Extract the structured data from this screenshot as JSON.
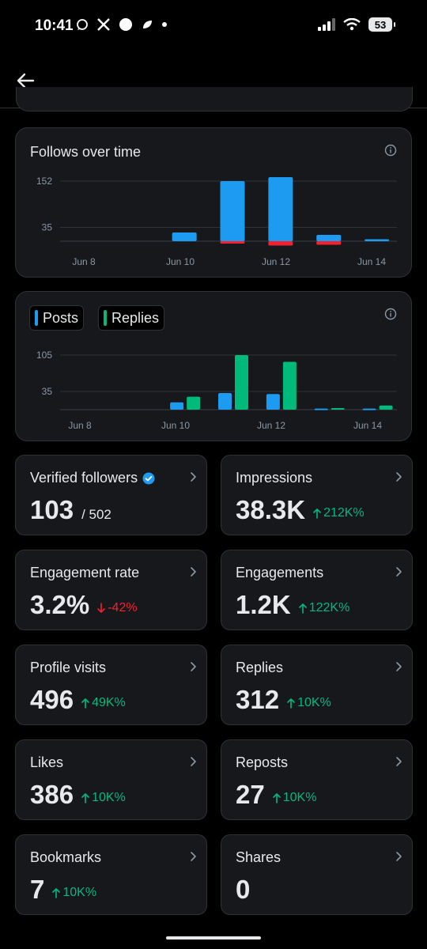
{
  "status_bar": {
    "time": "10:41",
    "battery": "53"
  },
  "colors": {
    "blue": "#1d9bf0",
    "green": "#00ba7c",
    "red": "#f4212e",
    "card": "#16181c",
    "border": "#2f3336"
  },
  "follows_chart": {
    "title": "Follows over time",
    "chart_data": {
      "type": "bar",
      "categories": [
        "Jun 8",
        "Jun 9",
        "Jun 10",
        "Jun 11",
        "Jun 12",
        "Jun 13",
        "Jun 14"
      ],
      "xtick_labels": [
        "Jun 8",
        "Jun 10",
        "Jun 12",
        "Jun 14"
      ],
      "yticks": [
        35,
        152
      ],
      "series": [
        {
          "values": [
            0,
            0,
            22,
            152,
            162,
            16,
            5
          ]
        },
        {
          "values": [
            0,
            0,
            0,
            -6,
            -11,
            -9,
            0
          ]
        }
      ],
      "ylim": [
        -20,
        165
      ],
      "grid": true
    }
  },
  "posts_replies_chart": {
    "legend": [
      "Posts",
      "Replies"
    ],
    "chart_data": {
      "type": "bar",
      "categories": [
        "Jun 8",
        "Jun 9",
        "Jun 10",
        "Jun 11",
        "Jun 12",
        "Jun 13",
        "Jun 14"
      ],
      "xtick_labels": [
        "Jun 8",
        "Jun 10",
        "Jun 12",
        "Jun 14"
      ],
      "yticks": [
        35,
        105
      ],
      "series": [
        {
          "name": "Posts",
          "values": [
            0,
            0,
            14,
            32,
            30,
            2,
            2
          ]
        },
        {
          "name": "Replies",
          "values": [
            0,
            0,
            25,
            105,
            92,
            3,
            8
          ]
        }
      ],
      "ylim": [
        0,
        115
      ],
      "grid": true
    }
  },
  "metrics": [
    {
      "label": "Verified followers",
      "value": "103",
      "sub": "/ 502",
      "change": "",
      "direction": "none",
      "verified": true
    },
    {
      "label": "Impressions",
      "value": "38.3K",
      "sub": "",
      "change": "212K%",
      "direction": "up",
      "verified": false
    },
    {
      "label": "Engagement rate",
      "value": "3.2%",
      "sub": "",
      "change": "-42%",
      "direction": "down",
      "verified": false
    },
    {
      "label": "Engagements",
      "value": "1.2K",
      "sub": "",
      "change": "122K%",
      "direction": "up",
      "verified": false
    },
    {
      "label": "Profile visits",
      "value": "496",
      "sub": "",
      "change": "49K%",
      "direction": "up",
      "verified": false
    },
    {
      "label": "Replies",
      "value": "312",
      "sub": "",
      "change": "10K%",
      "direction": "up",
      "verified": false
    },
    {
      "label": "Likes",
      "value": "386",
      "sub": "",
      "change": "10K%",
      "direction": "up",
      "verified": false
    },
    {
      "label": "Reposts",
      "value": "27",
      "sub": "",
      "change": "10K%",
      "direction": "up",
      "verified": false
    },
    {
      "label": "Bookmarks",
      "value": "7",
      "sub": "",
      "change": "10K%",
      "direction": "up",
      "verified": false
    },
    {
      "label": "Shares",
      "value": "0",
      "sub": "",
      "change": "",
      "direction": "none",
      "verified": false
    }
  ]
}
